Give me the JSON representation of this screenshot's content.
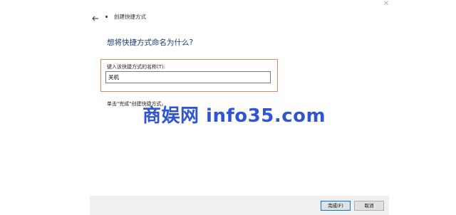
{
  "window": {
    "title": "创建快捷方式",
    "close_glyph": "✕",
    "back_glyph": "←"
  },
  "main": {
    "question": "想将快捷方式命名为什么?",
    "field_label": "键入该快捷方式的名称(T):",
    "name_value": "关机",
    "hint": "单击\"完成\"创建快捷方式。"
  },
  "watermark": {
    "text": "商娱网 info35.com"
  },
  "footer": {
    "finish_label": "完成(F)",
    "cancel_label": "取消"
  },
  "colors": {
    "highlight_border": "#e2855a",
    "question_text": "#1a3a7a",
    "watermark": "#2f55d4"
  }
}
